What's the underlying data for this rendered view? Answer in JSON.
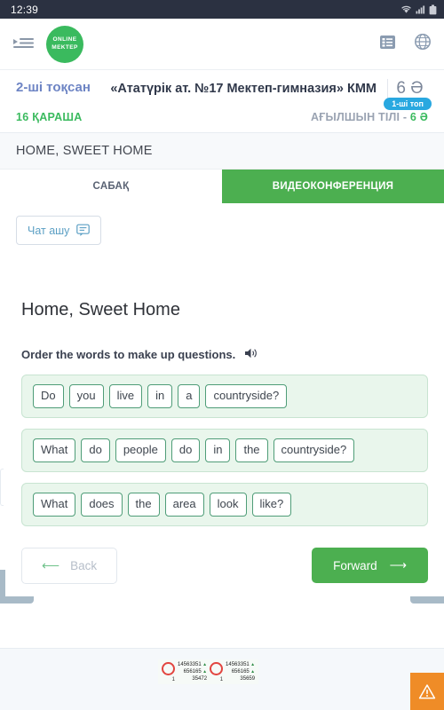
{
  "statusbar": {
    "clock": "12:39",
    "icons": [
      "wifi-icon",
      "signal-icon",
      "battery-icon"
    ]
  },
  "navbar": {
    "toggle_icon": "sidebar-toggle-icon",
    "logo_line1": "ONLINE",
    "logo_line2": "MEKTEP",
    "list_icon": "list-icon",
    "globe_icon": "globe-icon"
  },
  "school_header": {
    "quarter": "2-ші тоқсан",
    "school_name": "«Ататүрік ат. №17 Мектеп-гимназия» КММ",
    "grade": "6 Ә"
  },
  "date_row": {
    "date": "16 ҚАРАША",
    "subject": "АҒЫЛШЫН ТІЛІ - ",
    "subject_grade": "6 Ә",
    "group_badge": "1-ші топ"
  },
  "lesson_strip": {
    "title": "HOME, SWEET HOME"
  },
  "tabs": [
    {
      "label": "САБАҚ",
      "active": false
    },
    {
      "label": "ВИДЕОКОНФЕРЕНЦИЯ",
      "active": true
    }
  ],
  "chat": {
    "label": "Чат ашу",
    "icon": "chat-bubble-icon"
  },
  "content": {
    "menu_icon": "hamburger-menu-icon",
    "close_icon": "close-icon",
    "title": "Home, Sweet Home",
    "instruction": "Order the words to make up questions.",
    "audio_icon": "speaker-icon",
    "word_rows": [
      [
        "Do",
        "you",
        "live",
        "in",
        "a",
        "countryside?"
      ],
      [
        "What",
        "do",
        "people",
        "do",
        "in",
        "the",
        "countryside?"
      ],
      [
        "What",
        "does",
        "the",
        "area",
        "look",
        "like?"
      ]
    ]
  },
  "nav_buttons": {
    "back_label": "Back",
    "back_icon": "arrow-left-icon",
    "forward_label": "Forward",
    "forward_icon": "arrow-right-icon"
  },
  "bottom": {
    "counters": [
      {
        "index": "1",
        "line1": "14563351",
        "line2": "656165",
        "line3": "35472"
      },
      {
        "index": "1",
        "line1": "14563351",
        "line2": "656165",
        "line3": "35659"
      }
    ],
    "warning_icon": "warning-triangle-icon"
  },
  "colors": {
    "brand_green": "#4caf50",
    "logo_green": "#3aba5e",
    "badge_blue": "#29a8e0",
    "quarter_blue": "#6d84c4",
    "warn_orange": "#ef8c27",
    "statusbar_dark": "#2b3141"
  }
}
